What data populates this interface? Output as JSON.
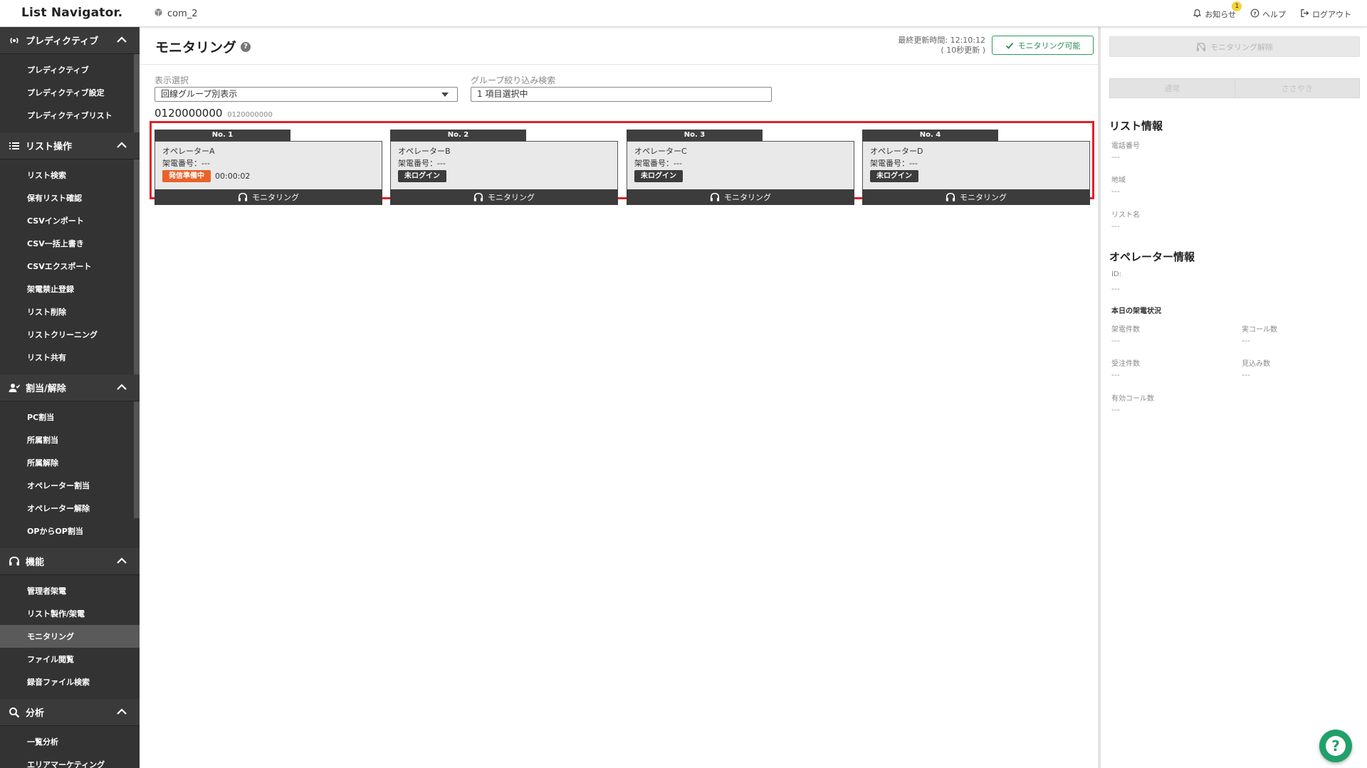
{
  "topbar": {
    "logo": "List Navigator.",
    "company": "com_2",
    "notifications_label": "お知らせ",
    "notifications_count": "1",
    "help_label": "ヘルプ",
    "logout_label": "ログアウト"
  },
  "sidebar": {
    "sections": [
      {
        "title": "プレディクティブ",
        "items": [
          "プレディクティブ",
          "プレディクティブ設定",
          "プレディクティブリスト"
        ]
      },
      {
        "title": "リスト操作",
        "items": [
          "リスト検索",
          "保有リスト確認",
          "CSVインポート",
          "CSV一括上書き",
          "CSVエクスポート",
          "架電禁止登録",
          "リスト削除",
          "リストクリーニング",
          "リスト共有"
        ]
      },
      {
        "title": "割当/解除",
        "items": [
          "PC割当",
          "所属割当",
          "所属解除",
          "オペレーター割当",
          "オペレーター解除",
          "OPからOP割当"
        ]
      },
      {
        "title": "機能",
        "items": [
          "管理者架電",
          "リスト製作/架電",
          "モニタリング",
          "ファイル閲覧",
          "録音ファイル検索"
        ]
      },
      {
        "title": "分析",
        "items": [
          "一覧分析",
          "エリアマーケティング"
        ]
      }
    ],
    "active_item": "モニタリング"
  },
  "main": {
    "title": "モニタリング",
    "last_update_line1": "最終更新時間: 12:10:12",
    "last_update_line2": "( 10秒更新 )",
    "monitor_ok_label": "モニタリング可能",
    "display_select_label": "表示選択",
    "display_select_value": "回線グループ別表示",
    "group_filter_label": "グループ絞り込み検索",
    "group_filter_value": "1 項目選択中",
    "line_number": "0120000000",
    "line_number_sub": "0120000000",
    "monitor_button_label": "モニタリング",
    "operators": [
      {
        "no": "No. 1",
        "name": "オペレーターA",
        "phone": "架電番号：---",
        "status": "発信準備中",
        "status_color": "#e8622a",
        "timer": "00:00:02"
      },
      {
        "no": "No. 2",
        "name": "オペレーターB",
        "phone": "架電番号：---",
        "status": "未ログイン",
        "status_color": "#3c3c3c",
        "timer": ""
      },
      {
        "no": "No. 3",
        "name": "オペレーターC",
        "phone": "架電番号：---",
        "status": "未ログイン",
        "status_color": "#3c3c3c",
        "timer": ""
      },
      {
        "no": "No. 4",
        "name": "オペレーターD",
        "phone": "架電番号：---",
        "status": "未ログイン",
        "status_color": "#3c3c3c",
        "timer": ""
      }
    ]
  },
  "right_panel": {
    "unmonitor_label": "モニタリング解除",
    "tab_normal": "通常",
    "tab_whisper": "ささやき",
    "list_info_title": "リスト情報",
    "phone_label": "電話番号",
    "phone_value": "---",
    "area_label": "地域",
    "area_value": "---",
    "list_name_label": "リスト名",
    "list_name_value": "---",
    "operator_info_title": "オペレーター情報",
    "id_label": "ID:",
    "id_value": "---",
    "today_status_label": "本日の架電状況",
    "calls_label": "架電件数",
    "calls_value": "---",
    "real_calls_label": "実コール数",
    "real_calls_value": "---",
    "orders_label": "受注件数",
    "orders_value": "---",
    "prospects_label": "見込み数",
    "prospects_value": "---",
    "valid_calls_label": "有効コール数",
    "valid_calls_value": "---"
  }
}
